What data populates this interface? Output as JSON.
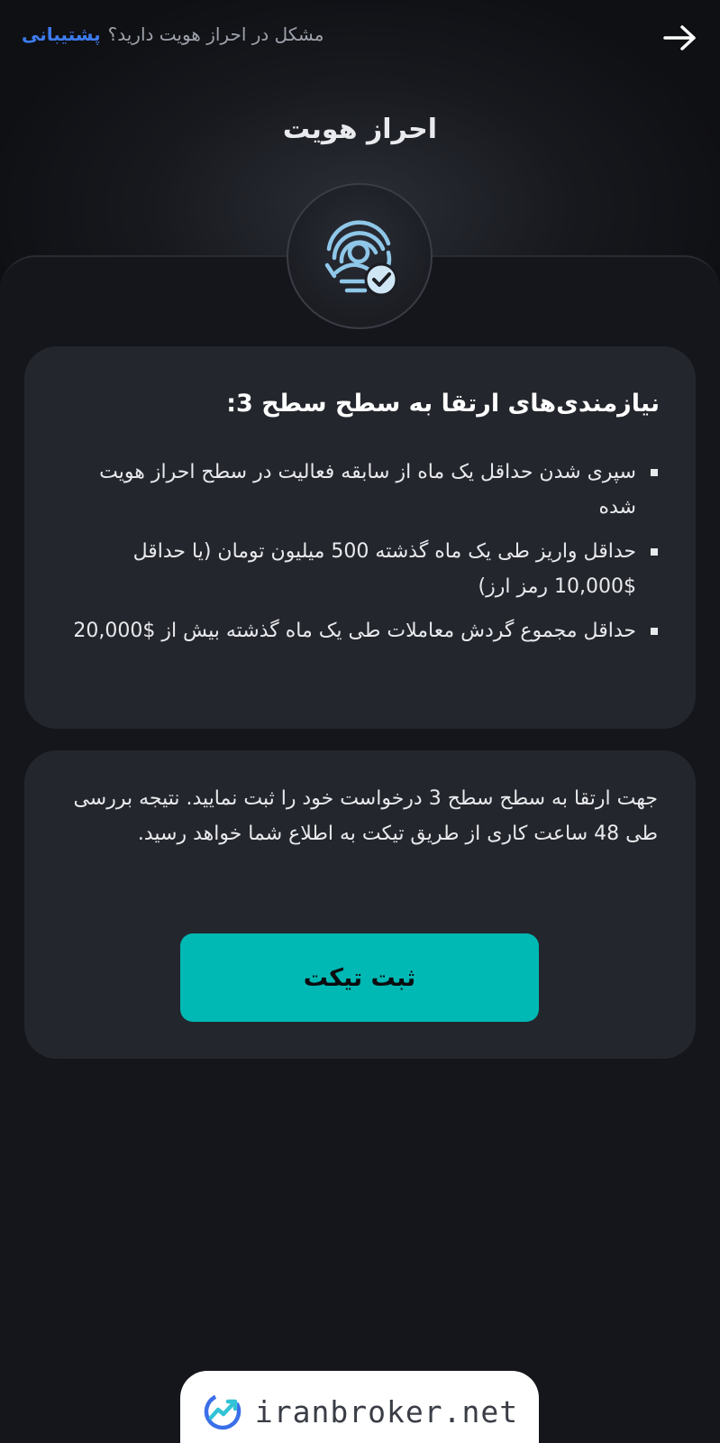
{
  "header": {
    "support_question": "مشکل در احراز هویت دارید؟",
    "support_link": "پشتیبانی",
    "title": "احراز هویت"
  },
  "icons": {
    "back": "arrow-right-icon",
    "identity": "fingerprint-verified-icon",
    "brand": "chart-trend-icon"
  },
  "requirements": {
    "title": "نیازمندی‌های ارتقا به سطح سطح 3:",
    "items": [
      "سپری شدن حداقل یک ماه از سابقه فعالیت در سطح احراز هویت شده",
      "حداقل واریز طی یک ماه گذشته 500 میلیون تومان (یا حداقل $10,000 رمز ارز)",
      "حداقل مجموع گردش معاملات طی یک ماه گذشته بیش از $20,000"
    ]
  },
  "request": {
    "text": "جهت ارتقا به سطح سطح 3 درخواست خود را ثبت نمایید. نتیجه بررسی طی 48 ساعت کاری از طریق تیکت به اطلاع شما خواهد رسید.",
    "button_label": "ثبت تیکت"
  },
  "watermark": {
    "text": "iranbroker.net"
  },
  "colors": {
    "accent": "#00b8b4",
    "link": "#3d7bf0",
    "background": "#0f1014",
    "card": "#24262d",
    "icon_blue": "#8fc7e8"
  }
}
